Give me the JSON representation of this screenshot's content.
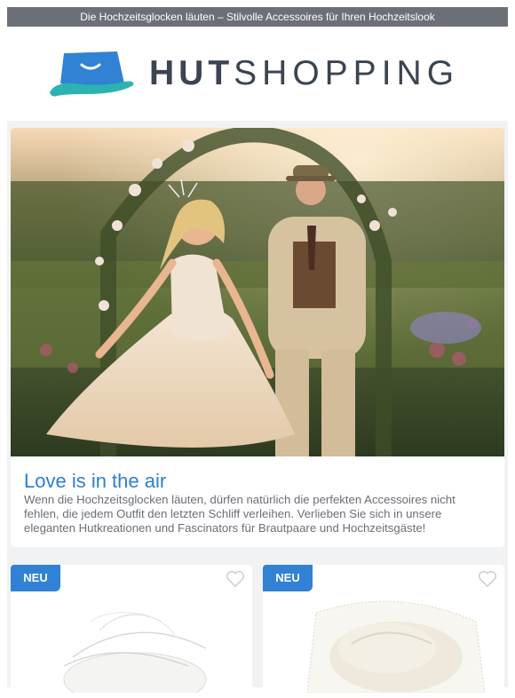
{
  "banner": {
    "text": "Die Hochzeitsglocken läuten – Stilvolle Accessoires für Ihren Hochzeitslook"
  },
  "brand": {
    "name_bold": "HUT",
    "name_light": "SHOPPING",
    "logo_icon": "hat-icon",
    "accent": "#3182d4",
    "teal": "#2bb3b1"
  },
  "hero": {
    "image_icon": "wedding-couple-photo",
    "title": "Love is in the air",
    "text": "Wenn die Hochzeitsglocken läuten, dürfen natürlich die perfekten Accessoires nicht fehlen, die jedem Outfit den letzten Schliff verleihen. Verlieben Sie sich in unsere eleganten Hutkreationen und Fascinators für Brautpaare und Hochzeitsgäste!"
  },
  "products": [
    {
      "badge": "NEU",
      "image_icon": "white-feather-fascinator",
      "favorite_icon": "heart-icon"
    },
    {
      "badge": "NEU",
      "image_icon": "ivory-sinamay-hat-with-veil",
      "favorite_icon": "heart-icon"
    }
  ]
}
